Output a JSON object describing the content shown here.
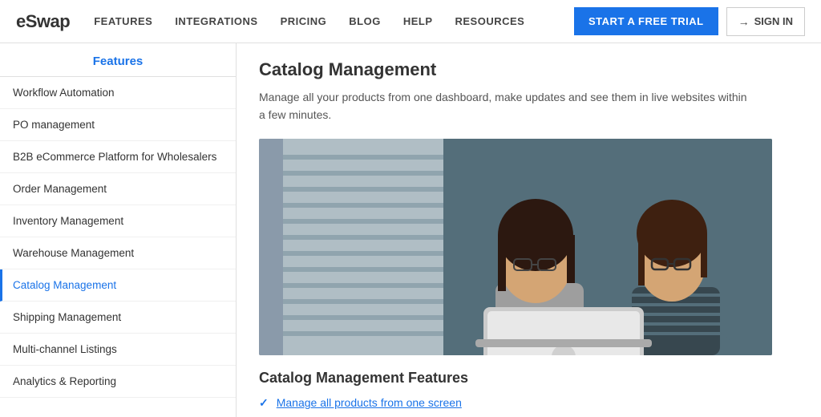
{
  "header": {
    "logo": "eSwap",
    "nav_items": [
      {
        "label": "FEATURES"
      },
      {
        "label": "INTEGRATIONS"
      },
      {
        "label": "PRICING"
      },
      {
        "label": "BLOG"
      },
      {
        "label": "HELP"
      },
      {
        "label": "RESOURCES"
      }
    ],
    "trial_button": "START A FREE TRIAL",
    "signin_button": "SIGN IN"
  },
  "sidebar": {
    "heading": "Features",
    "items": [
      {
        "label": "Workflow Automation",
        "active": false
      },
      {
        "label": "PO management",
        "active": false
      },
      {
        "label": "B2B eCommerce Platform for Wholesalers",
        "active": false
      },
      {
        "label": "Order Management",
        "active": false
      },
      {
        "label": "Inventory Management",
        "active": false
      },
      {
        "label": "Warehouse Management",
        "active": false
      },
      {
        "label": "Catalog Management",
        "active": true
      },
      {
        "label": "Shipping Management",
        "active": false
      },
      {
        "label": "Multi-channel Listings",
        "active": false
      },
      {
        "label": "Analytics & Reporting",
        "active": false
      }
    ]
  },
  "content": {
    "title": "Catalog Management",
    "description": "Manage all your products from one dashboard, make updates and see them in live websites within a few minutes.",
    "features_title": "Catalog Management Features",
    "features": [
      {
        "label": "Manage all products from one screen"
      }
    ]
  }
}
